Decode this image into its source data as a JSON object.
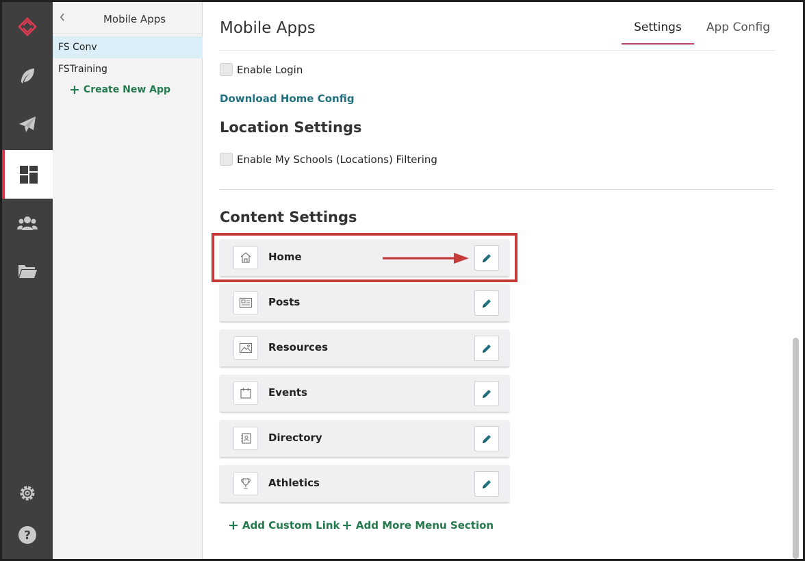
{
  "rail": {
    "accent_color": "#d8334a",
    "items": [
      {
        "icon": "logo-icon"
      },
      {
        "icon": "feather-icon"
      },
      {
        "icon": "paper-plane-icon"
      },
      {
        "icon": "dashboard-icon",
        "active": true
      },
      {
        "icon": "users-icon"
      },
      {
        "icon": "folder-icon"
      },
      {
        "icon": "gear-icon"
      },
      {
        "icon": "help-icon"
      }
    ]
  },
  "panel": {
    "title": "Mobile Apps",
    "apps": [
      {
        "label": "FS Conv",
        "selected": true
      },
      {
        "label": "FSTraining",
        "selected": false
      }
    ],
    "create_label": "Create New App"
  },
  "main": {
    "title": "Mobile Apps",
    "tabs": [
      {
        "label": "Settings",
        "active": true
      },
      {
        "label": "App Config",
        "active": false
      }
    ],
    "enable_login_label": "Enable Login",
    "download_config_label": "Download Home Config",
    "location_settings_title": "Location Settings",
    "filtering_label": "Enable My Schools (Locations) Filtering",
    "content_settings_title": "Content Settings",
    "content_items": [
      {
        "label": "Home",
        "icon": "home-icon"
      },
      {
        "label": "Posts",
        "icon": "newspaper-icon"
      },
      {
        "label": "Resources",
        "icon": "image-icon"
      },
      {
        "label": "Events",
        "icon": "calendar-icon"
      },
      {
        "label": "Directory",
        "icon": "contact-card-icon"
      },
      {
        "label": "Athletics",
        "icon": "trophy-icon"
      }
    ],
    "add_custom_link_label": "Add Custom Link",
    "add_menu_section_label": "Add More Menu Section"
  },
  "colors": {
    "link_teal": "#1f6f7e",
    "action_green": "#237a4d",
    "highlight_red": "#c73b39",
    "tab_underline": "#c24171"
  }
}
